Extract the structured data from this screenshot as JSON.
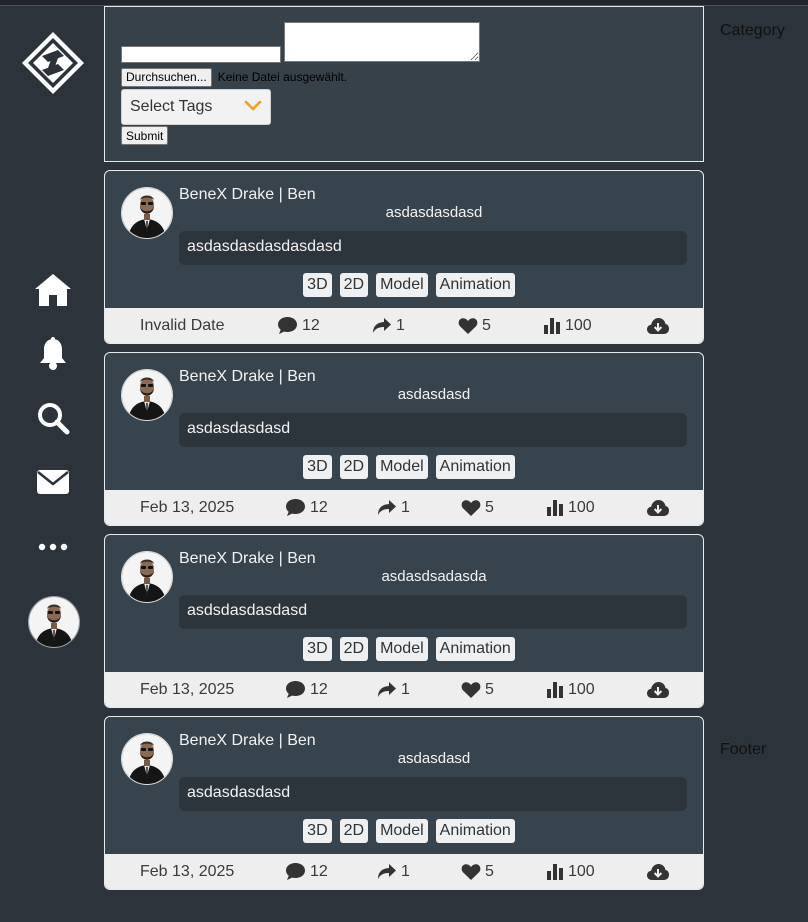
{
  "compose": {
    "title_value": "",
    "content_value": "",
    "file_button": "Durchsuchen...",
    "file_status": "Keine Datei ausgewählt.",
    "tag_placeholder": "Select Tags",
    "submit_label": "Submit"
  },
  "sidebar": {
    "items": [
      {
        "icon": "home-icon"
      },
      {
        "icon": "bell-icon"
      },
      {
        "icon": "search-icon"
      },
      {
        "icon": "mail-icon"
      },
      {
        "icon": "more-icon"
      }
    ]
  },
  "right": {
    "category_label": "Category",
    "footer_label": "Footer"
  },
  "posts": [
    {
      "author": "BeneX Drake | Ben",
      "title": "asdasdasdasd",
      "body": "asdasdasdasdasdasd",
      "tags": [
        "3D",
        "2D",
        "Model",
        "Animation"
      ],
      "date": "Invalid Date",
      "comments": "12",
      "shares": "1",
      "likes": "5",
      "views": "100"
    },
    {
      "author": "BeneX Drake | Ben",
      "title": "asdasdasd",
      "body": "asdasdasdasd",
      "tags": [
        "3D",
        "2D",
        "Model",
        "Animation"
      ],
      "date": "Feb 13, 2025",
      "comments": "12",
      "shares": "1",
      "likes": "5",
      "views": "100"
    },
    {
      "author": "BeneX Drake | Ben",
      "title": "asdasdsadasda",
      "body": "asdsdasdasdasd",
      "tags": [
        "3D",
        "2D",
        "Model",
        "Animation"
      ],
      "date": "Feb 13, 2025",
      "comments": "12",
      "shares": "1",
      "likes": "5",
      "views": "100"
    },
    {
      "author": "BeneX Drake | Ben",
      "title": "asdasdasd",
      "body": "asdasdasdasd",
      "tags": [
        "3D",
        "2D",
        "Model",
        "Animation"
      ],
      "date": "Feb 13, 2025",
      "comments": "12",
      "shares": "1",
      "likes": "5",
      "views": "100"
    }
  ],
  "colors": {
    "background": "#2d333b",
    "card": "#37434d",
    "footer_bar": "#eeeeee",
    "chevron": "#f0a020"
  }
}
